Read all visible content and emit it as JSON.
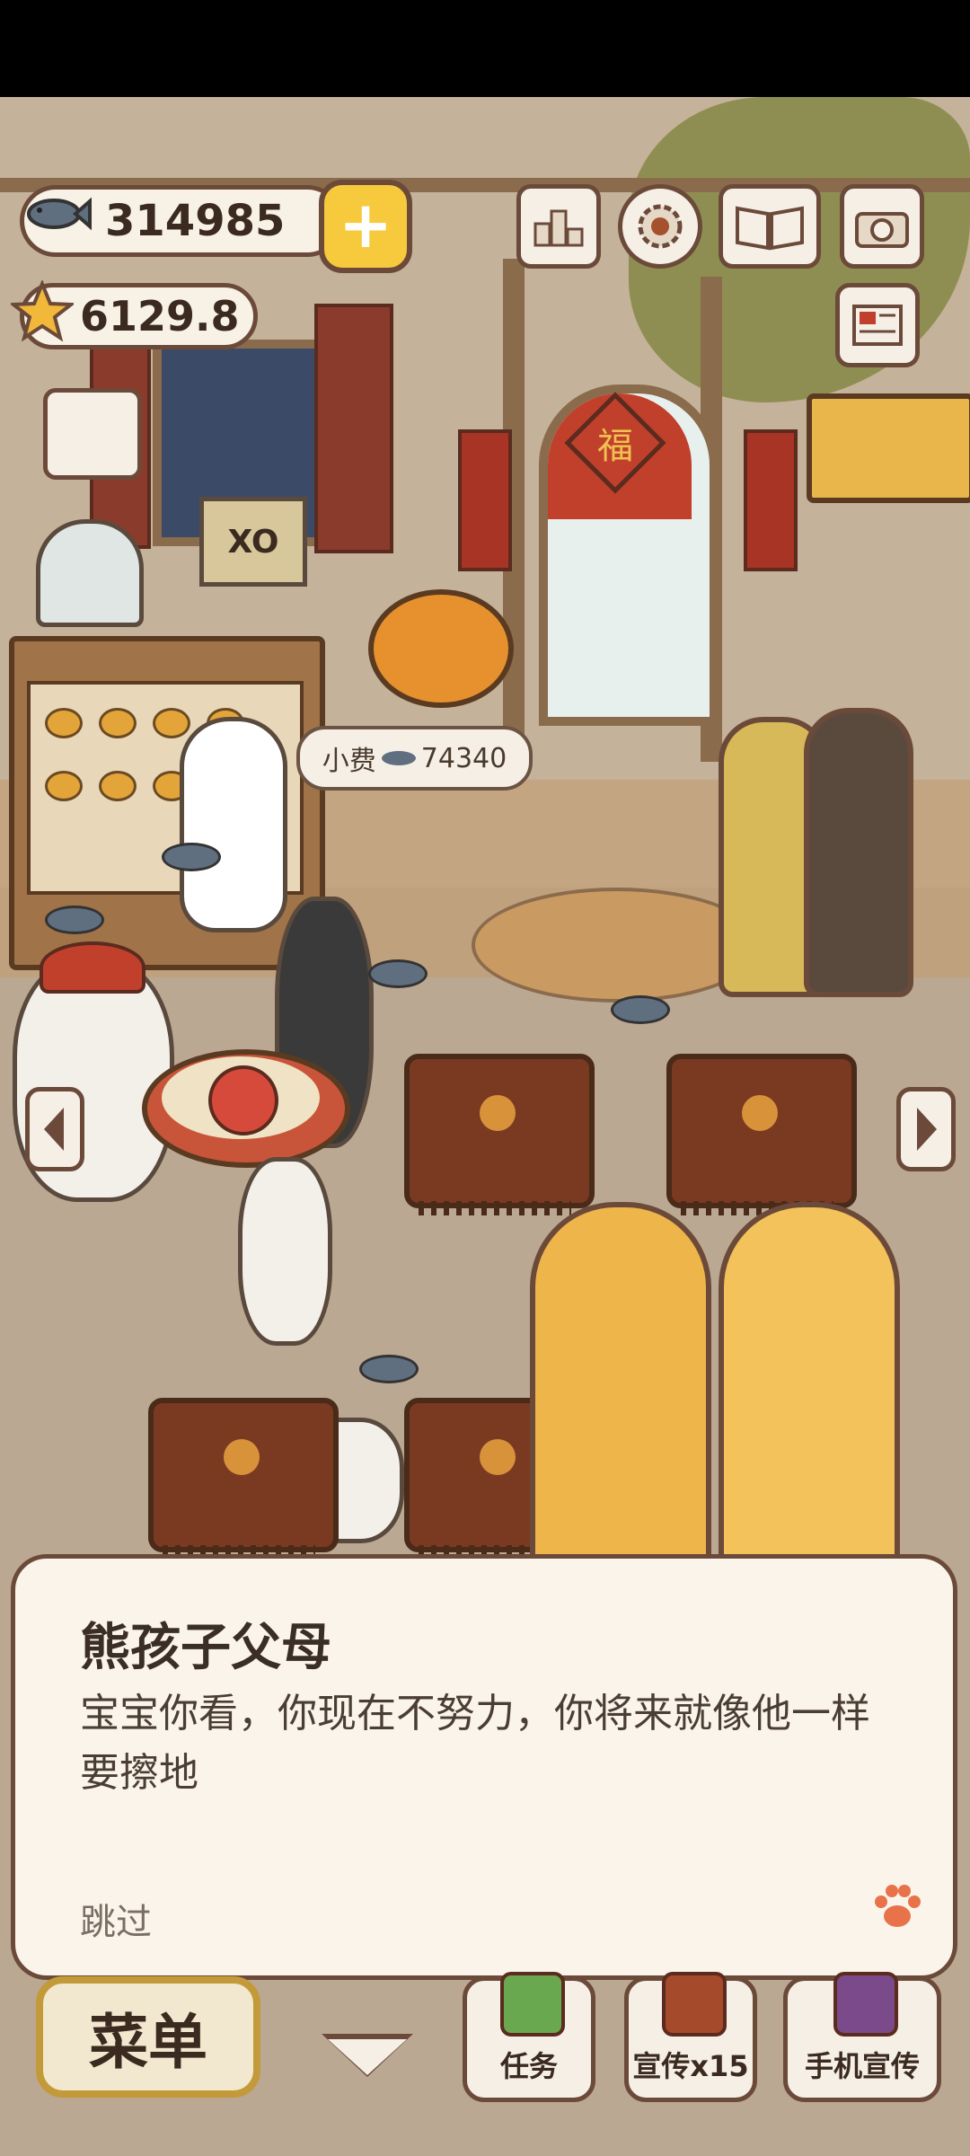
{
  "hud": {
    "fish_count": "314985",
    "star_count": "6129.8",
    "plus_label": "+"
  },
  "scene": {
    "tip_label": "小费",
    "tip_amount": "74340",
    "door_sign": "福",
    "box_label": "XO"
  },
  "top_icons": [
    "ranking-icon",
    "settings-gear-icon",
    "guide-book-icon",
    "camera-icon",
    "newspaper-icon"
  ],
  "dialog": {
    "speaker": "熊孩子父母",
    "text": "宝宝你看，你现在不努力，你将来就像他一样要擦地",
    "skip_label": "跳过"
  },
  "bottom_bar": {
    "menu_label": "菜单",
    "task_label": "任务",
    "promo_label": "宣传x15",
    "phone_promo_label": "手机宣传"
  },
  "colors": {
    "panel_bg": "#fbf4ea",
    "outline": "#6b4a3a",
    "accent_yellow": "#f7c93c",
    "paw_orange": "#e8734a"
  }
}
